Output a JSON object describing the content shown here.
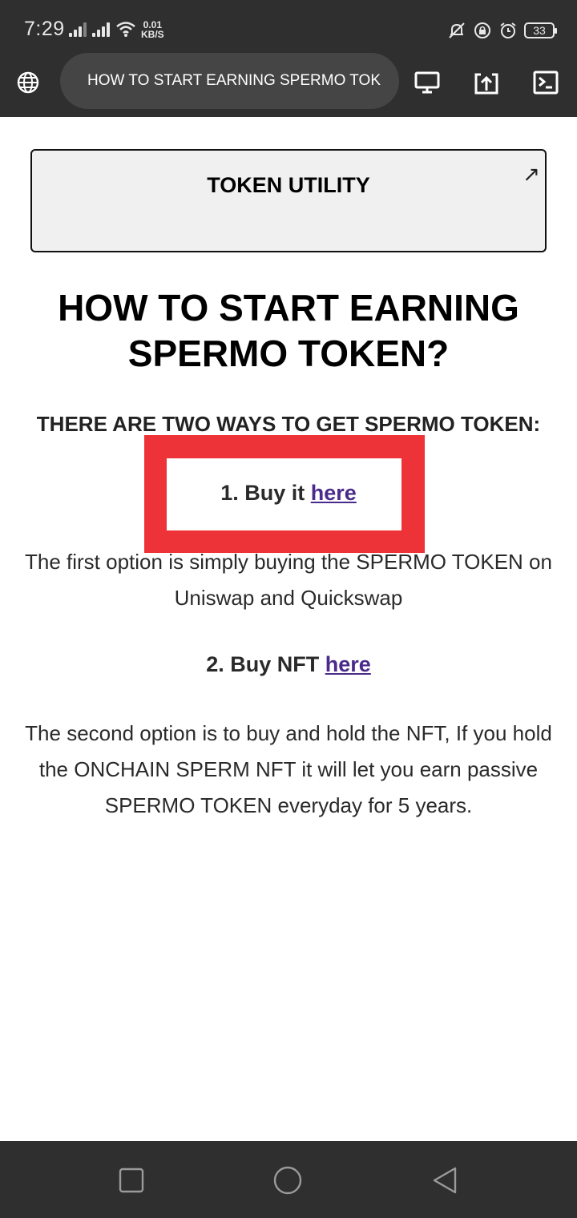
{
  "status": {
    "time": "7:29",
    "net_speed_value": "0.01",
    "net_speed_unit": "KB/S",
    "battery": "33"
  },
  "browser": {
    "url_title": "HOW TO START EARNING SPERMO TOK"
  },
  "page": {
    "utility_box_title": "TOKEN UTILITY",
    "ext_arrow": "↗",
    "heading_line1": "HOW TO START EARNING",
    "heading_line2": "SPERMO TOKEN?",
    "subheading": "THERE ARE TWO WAYS TO GET SPERMO TOKEN:",
    "option1_prefix": "1. Buy it ",
    "option1_link": "here",
    "option1_desc_line1": "The first option is simply buying the SPERMO TOKEN on",
    "option1_desc_line2": "Uniswap and Quickswap",
    "option2_prefix": "2. Buy NFT ",
    "option2_link": "here",
    "option2_desc_line1": "The second option is to buy and hold the NFT, If you hold",
    "option2_desc_line2": "the ONCHAIN SPERM NFT it will let you earn passive",
    "option2_desc_line3": "SPERMO TOKEN everyday for 5 years."
  },
  "colors": {
    "highlight": "#ee3338",
    "link": "#4a2a8a",
    "bar_bg": "#2f2f2f"
  }
}
